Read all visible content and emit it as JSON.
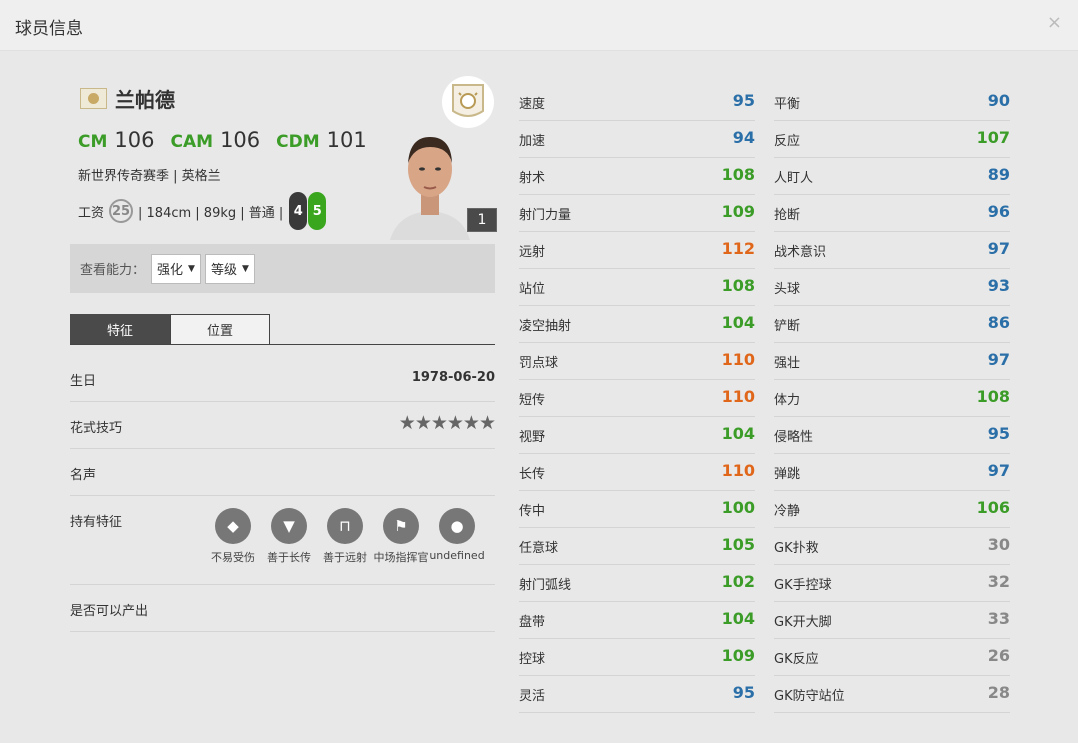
{
  "header": {
    "title": "球员信息",
    "close_glyph": "×"
  },
  "player": {
    "name": "兰帕德",
    "positions": [
      {
        "code": "CM",
        "value": "106"
      },
      {
        "code": "CAM",
        "value": "106"
      },
      {
        "code": "CDM",
        "value": "101"
      }
    ],
    "season_line": "新世界传奇赛季 | 英格兰",
    "wage_label": "工资",
    "wage": "25",
    "details": "| 184cm | 89kg | 普通 |",
    "weak_foot_left": "4",
    "weak_foot_right": "5",
    "card_number": "1"
  },
  "ability": {
    "label": "查看能力：",
    "select1": "强化",
    "select2": "等级"
  },
  "tabs": [
    {
      "label": "特征",
      "active": true
    },
    {
      "label": "位置",
      "active": false
    }
  ],
  "info": {
    "birth_label": "生日",
    "birth_value": "1978-06-20",
    "skill_label": "花式技巧",
    "skill_stars": "★★★★★★",
    "fame_label": "名声",
    "traits_label": "持有特征",
    "traits": [
      {
        "label": "不易受伤",
        "icon": "diamond-icon"
      },
      {
        "label": "善于长传",
        "icon": "tie-icon"
      },
      {
        "label": "善于远射",
        "icon": "goal-icon"
      },
      {
        "label": "中场指挥官",
        "icon": "flag-icon"
      },
      {
        "label": "undefined",
        "icon": "ball-icon"
      }
    ],
    "output_label": "是否可以产出"
  },
  "colors": {
    "blue": "#2b6fa8",
    "green": "#3b9c27",
    "orange": "#e0661a",
    "gray": "#888888"
  },
  "stats_col1": [
    {
      "label": "速度",
      "value": "95",
      "color": "blue"
    },
    {
      "label": "加速",
      "value": "94",
      "color": "blue"
    },
    {
      "label": "射术",
      "value": "108",
      "color": "green"
    },
    {
      "label": "射门力量",
      "value": "109",
      "color": "green"
    },
    {
      "label": "远射",
      "value": "112",
      "color": "orange"
    },
    {
      "label": "站位",
      "value": "108",
      "color": "green"
    },
    {
      "label": "凌空抽射",
      "value": "104",
      "color": "green"
    },
    {
      "label": "罚点球",
      "value": "110",
      "color": "orange"
    },
    {
      "label": "短传",
      "value": "110",
      "color": "orange"
    },
    {
      "label": "视野",
      "value": "104",
      "color": "green"
    },
    {
      "label": "长传",
      "value": "110",
      "color": "orange"
    },
    {
      "label": "传中",
      "value": "100",
      "color": "green"
    },
    {
      "label": "任意球",
      "value": "105",
      "color": "green"
    },
    {
      "label": "射门弧线",
      "value": "102",
      "color": "green"
    },
    {
      "label": "盘带",
      "value": "104",
      "color": "green"
    },
    {
      "label": "控球",
      "value": "109",
      "color": "green"
    },
    {
      "label": "灵活",
      "value": "95",
      "color": "blue"
    }
  ],
  "stats_col2": [
    {
      "label": "平衡",
      "value": "90",
      "color": "blue"
    },
    {
      "label": "反应",
      "value": "107",
      "color": "green"
    },
    {
      "label": "人盯人",
      "value": "89",
      "color": "blue"
    },
    {
      "label": "抢断",
      "value": "96",
      "color": "blue"
    },
    {
      "label": "战术意识",
      "value": "97",
      "color": "blue"
    },
    {
      "label": "头球",
      "value": "93",
      "color": "blue"
    },
    {
      "label": "铲断",
      "value": "86",
      "color": "blue"
    },
    {
      "label": "强壮",
      "value": "97",
      "color": "blue"
    },
    {
      "label": "体力",
      "value": "108",
      "color": "green"
    },
    {
      "label": "侵略性",
      "value": "95",
      "color": "blue"
    },
    {
      "label": "弹跳",
      "value": "97",
      "color": "blue"
    },
    {
      "label": "冷静",
      "value": "106",
      "color": "green"
    },
    {
      "label": "GK扑救",
      "value": "30",
      "color": "gray"
    },
    {
      "label": "GK手控球",
      "value": "32",
      "color": "gray"
    },
    {
      "label": "GK开大脚",
      "value": "33",
      "color": "gray"
    },
    {
      "label": "GK反应",
      "value": "26",
      "color": "gray"
    },
    {
      "label": "GK防守站位",
      "value": "28",
      "color": "gray"
    }
  ]
}
